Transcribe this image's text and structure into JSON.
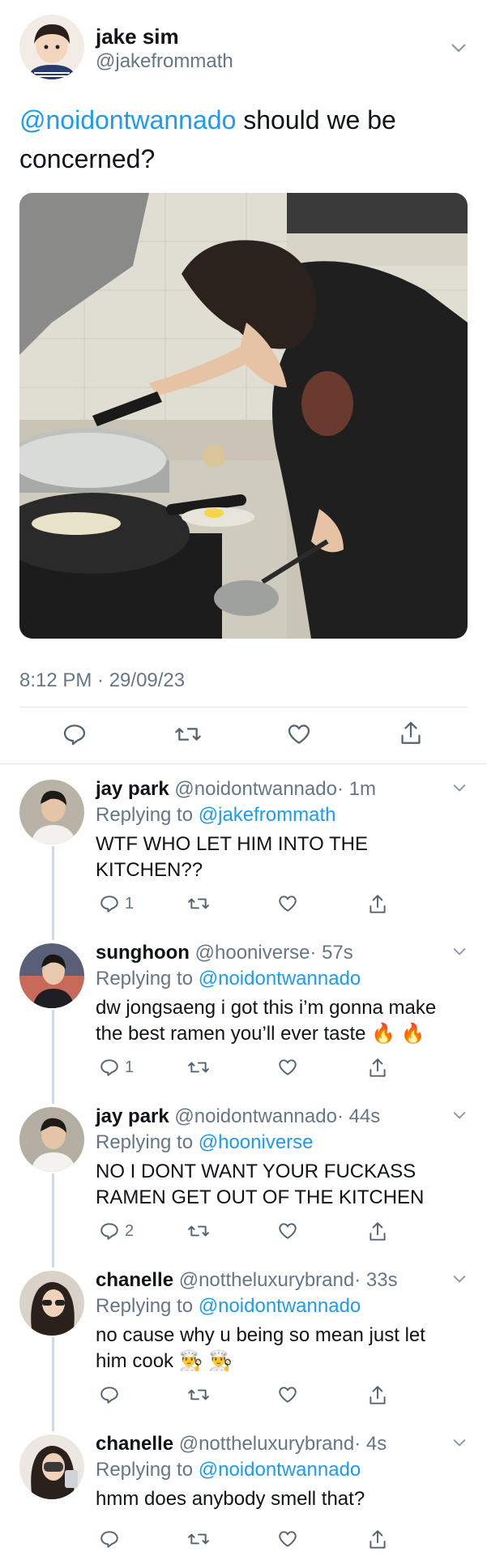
{
  "main_tweet": {
    "name": "jake sim",
    "handle": "@jakefrommath",
    "mention": "@noidontwannado",
    "text": " should we be concerned?",
    "media_alt": "photo of a person cooking at a stove",
    "timestamp": "8:12 PM · 29/09/23",
    "actions": [
      "reply-icon",
      "retweet-icon",
      "like-icon",
      "share-icon"
    ]
  },
  "replies": [
    {
      "name": "jay park",
      "handle": "@noidontwannado",
      "time": "· 1m",
      "replying_label": "Replying to",
      "replying_to": "@jakefrommath",
      "line1": "WTF WHO LET HIM INTO THE",
      "line2": "KITCHEN??",
      "reply_count": "1"
    },
    {
      "name": "sunghoon",
      "handle": "@hooniverse",
      "time": "· 57s",
      "replying_label": "Replying to",
      "replying_to": "@noidontwannado",
      "line1": "dw jongsaeng i got this i’m gonna make",
      "line2": "the best ramen you’ll ever taste 🔥 🔥",
      "reply_count": "1"
    },
    {
      "name": "jay park",
      "handle": "@noidontwannado",
      "time": "· 44s",
      "replying_label": "Replying to",
      "replying_to": "@hooniverse",
      "line1": "NO I DONT WANT YOUR FUCKASS",
      "line2": "RAMEN GET OUT OF THE KITCHEN",
      "reply_count": "2"
    },
    {
      "name": "chanelle",
      "handle": "@nottheluxurybrand",
      "time": "· 33s",
      "replying_label": "Replying to",
      "replying_to": "@noidontwannado",
      "line1": "no cause why u being so mean just let",
      "line2": "him cook 👨‍🍳 👨‍🍳",
      "reply_count": ""
    },
    {
      "name": "chanelle",
      "handle": "@nottheluxurybrand",
      "time": "· 4s",
      "replying_label": "Replying to",
      "replying_to": "@noidontwannado",
      "line1": "hmm does anybody smell that?",
      "line2": "",
      "reply_count": ""
    }
  ],
  "colors": {
    "link": "#1d9bf0",
    "muted": "#657786",
    "text": "#0f1419",
    "divider": "#e1e8ed"
  }
}
